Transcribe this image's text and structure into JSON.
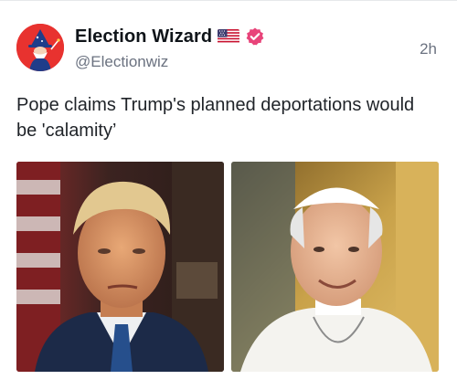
{
  "author": {
    "display_name": "Election Wizard",
    "handle": "@Electionwiz",
    "avatar_icon": "wizard-avatar-icon",
    "flag_icon": "us-flag-icon",
    "verified_icon": "verified-badge-icon",
    "verified_color": "#e8447a",
    "brand_color": "#e8322f"
  },
  "post": {
    "timestamp": "2h",
    "text": "Pope claims Trump's planned deportations would be 'calamity’"
  },
  "media": [
    {
      "name": "trump-photo",
      "background": "#3a1f1c"
    },
    {
      "name": "pope-photo",
      "background": "#c9a24a"
    }
  ]
}
